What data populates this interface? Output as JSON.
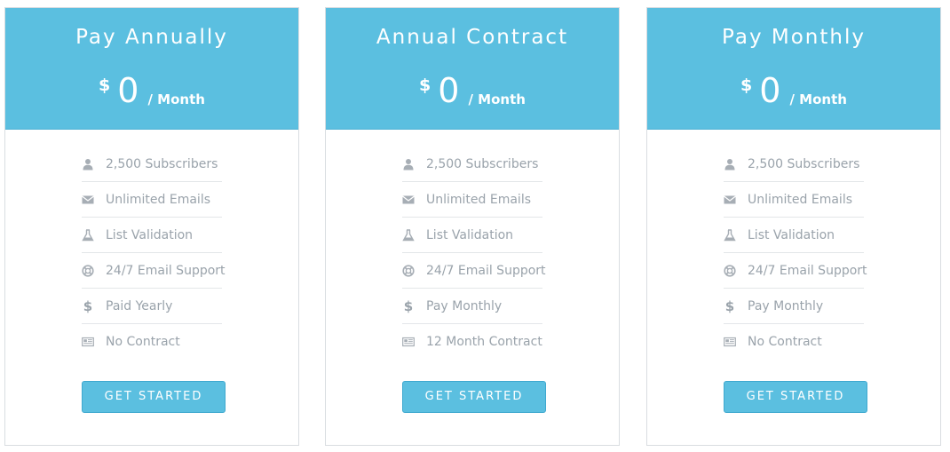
{
  "plans": [
    {
      "title": "Pay Annually",
      "currency": "$",
      "amount": "0",
      "period": "/ Month",
      "features": [
        {
          "icon": "user-icon",
          "label": "2,500 Subscribers"
        },
        {
          "icon": "envelope-icon",
          "label": "Unlimited Emails"
        },
        {
          "icon": "flask-icon",
          "label": "List Validation"
        },
        {
          "icon": "lifebuoy-icon",
          "label": "24/7 Email Support"
        },
        {
          "icon": "dollar-icon",
          "label": "Paid Yearly"
        },
        {
          "icon": "newspaper-icon",
          "label": "No Contract"
        }
      ],
      "cta": "GET STARTED"
    },
    {
      "title": "Annual Contract",
      "currency": "$",
      "amount": "0",
      "period": "/ Month",
      "features": [
        {
          "icon": "user-icon",
          "label": "2,500 Subscribers"
        },
        {
          "icon": "envelope-icon",
          "label": "Unlimited Emails"
        },
        {
          "icon": "flask-icon",
          "label": "List Validation"
        },
        {
          "icon": "lifebuoy-icon",
          "label": "24/7 Email Support"
        },
        {
          "icon": "dollar-icon",
          "label": "Pay Monthly"
        },
        {
          "icon": "newspaper-icon",
          "label": "12 Month Contract"
        }
      ],
      "cta": "GET STARTED"
    },
    {
      "title": "Pay Monthly",
      "currency": "$",
      "amount": "0",
      "period": "/ Month",
      "features": [
        {
          "icon": "user-icon",
          "label": "2,500 Subscribers"
        },
        {
          "icon": "envelope-icon",
          "label": "Unlimited Emails"
        },
        {
          "icon": "flask-icon",
          "label": "List Validation"
        },
        {
          "icon": "lifebuoy-icon",
          "label": "24/7 Email Support"
        },
        {
          "icon": "dollar-icon",
          "label": "Pay Monthly"
        },
        {
          "icon": "newspaper-icon",
          "label": "No Contract"
        }
      ],
      "cta": "GET STARTED"
    }
  ],
  "colors": {
    "accent": "#5bbfe0",
    "feature_text": "#9aa3ab",
    "divider": "#e3e6e9"
  }
}
